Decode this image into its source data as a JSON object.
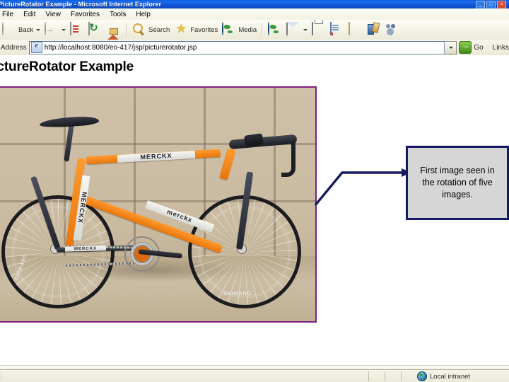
{
  "window": {
    "title": "PictureRotator Example - Microsoft Internet Explorer",
    "minimize_label": "_",
    "maximize_label": "□",
    "close_label": "×"
  },
  "menu": {
    "items": [
      {
        "label": "File"
      },
      {
        "label": "Edit"
      },
      {
        "label": "View"
      },
      {
        "label": "Favorites"
      },
      {
        "label": "Tools"
      },
      {
        "label": "Help"
      }
    ]
  },
  "toolbar": {
    "back_label": "Back",
    "forward_label": "Forward",
    "stop_label": "Stop",
    "refresh_label": "Refresh",
    "home_label": "Home",
    "search_label": "Search",
    "favorites_label": "Favorites",
    "media_label": "Media",
    "history_label": "History",
    "mail_label": "Mail",
    "print_label": "Print",
    "edit_label": "Edit",
    "discuss_label": "Discuss",
    "messenger_label": "Messenger",
    "people_label": "People",
    "icons": {
      "back": "back-arrow-icon",
      "forward": "forward-arrow-icon",
      "stop": "stop-icon",
      "refresh": "refresh-icon",
      "home": "home-icon",
      "search": "search-icon",
      "favorites": "star-icon",
      "media": "media-globe-icon",
      "history": "history-globe-icon",
      "mail": "mail-icon",
      "print": "print-icon",
      "edit": "edit-page-icon",
      "discuss": "folder-icon",
      "messenger": "messenger-icon",
      "people": "people-icon"
    }
  },
  "address": {
    "label": "Address",
    "url": "http://localhost:8080/eo-417/jsp/picturerotator.jsp",
    "placeholder": "http://",
    "go_label": "Go",
    "links_label": "Links"
  },
  "page": {
    "heading": "PictureRotator Example",
    "image": {
      "alt": "Orange Eddy Merckx road bicycle leaning against a tan block wall",
      "border_color": "#7d1f7d",
      "frame_decals": {
        "top_tube": "MERCKX",
        "seat_tube": "MERCKX",
        "down_tube": "merckx",
        "chain_stay": "MERCKX",
        "rear_rim": "SHIMANO",
        "front_rim": "SHIMANO"
      }
    },
    "callout": {
      "text": "First image seen in the rotation of five images.",
      "border_color": "#151b63",
      "fill_color": "#d6d6d6",
      "arrow_color": "#151b63",
      "arrow_name": "elbow-arrow-connector"
    }
  },
  "status": {
    "zone_text": "Local intranet",
    "zone_icon": "globe-icon"
  }
}
